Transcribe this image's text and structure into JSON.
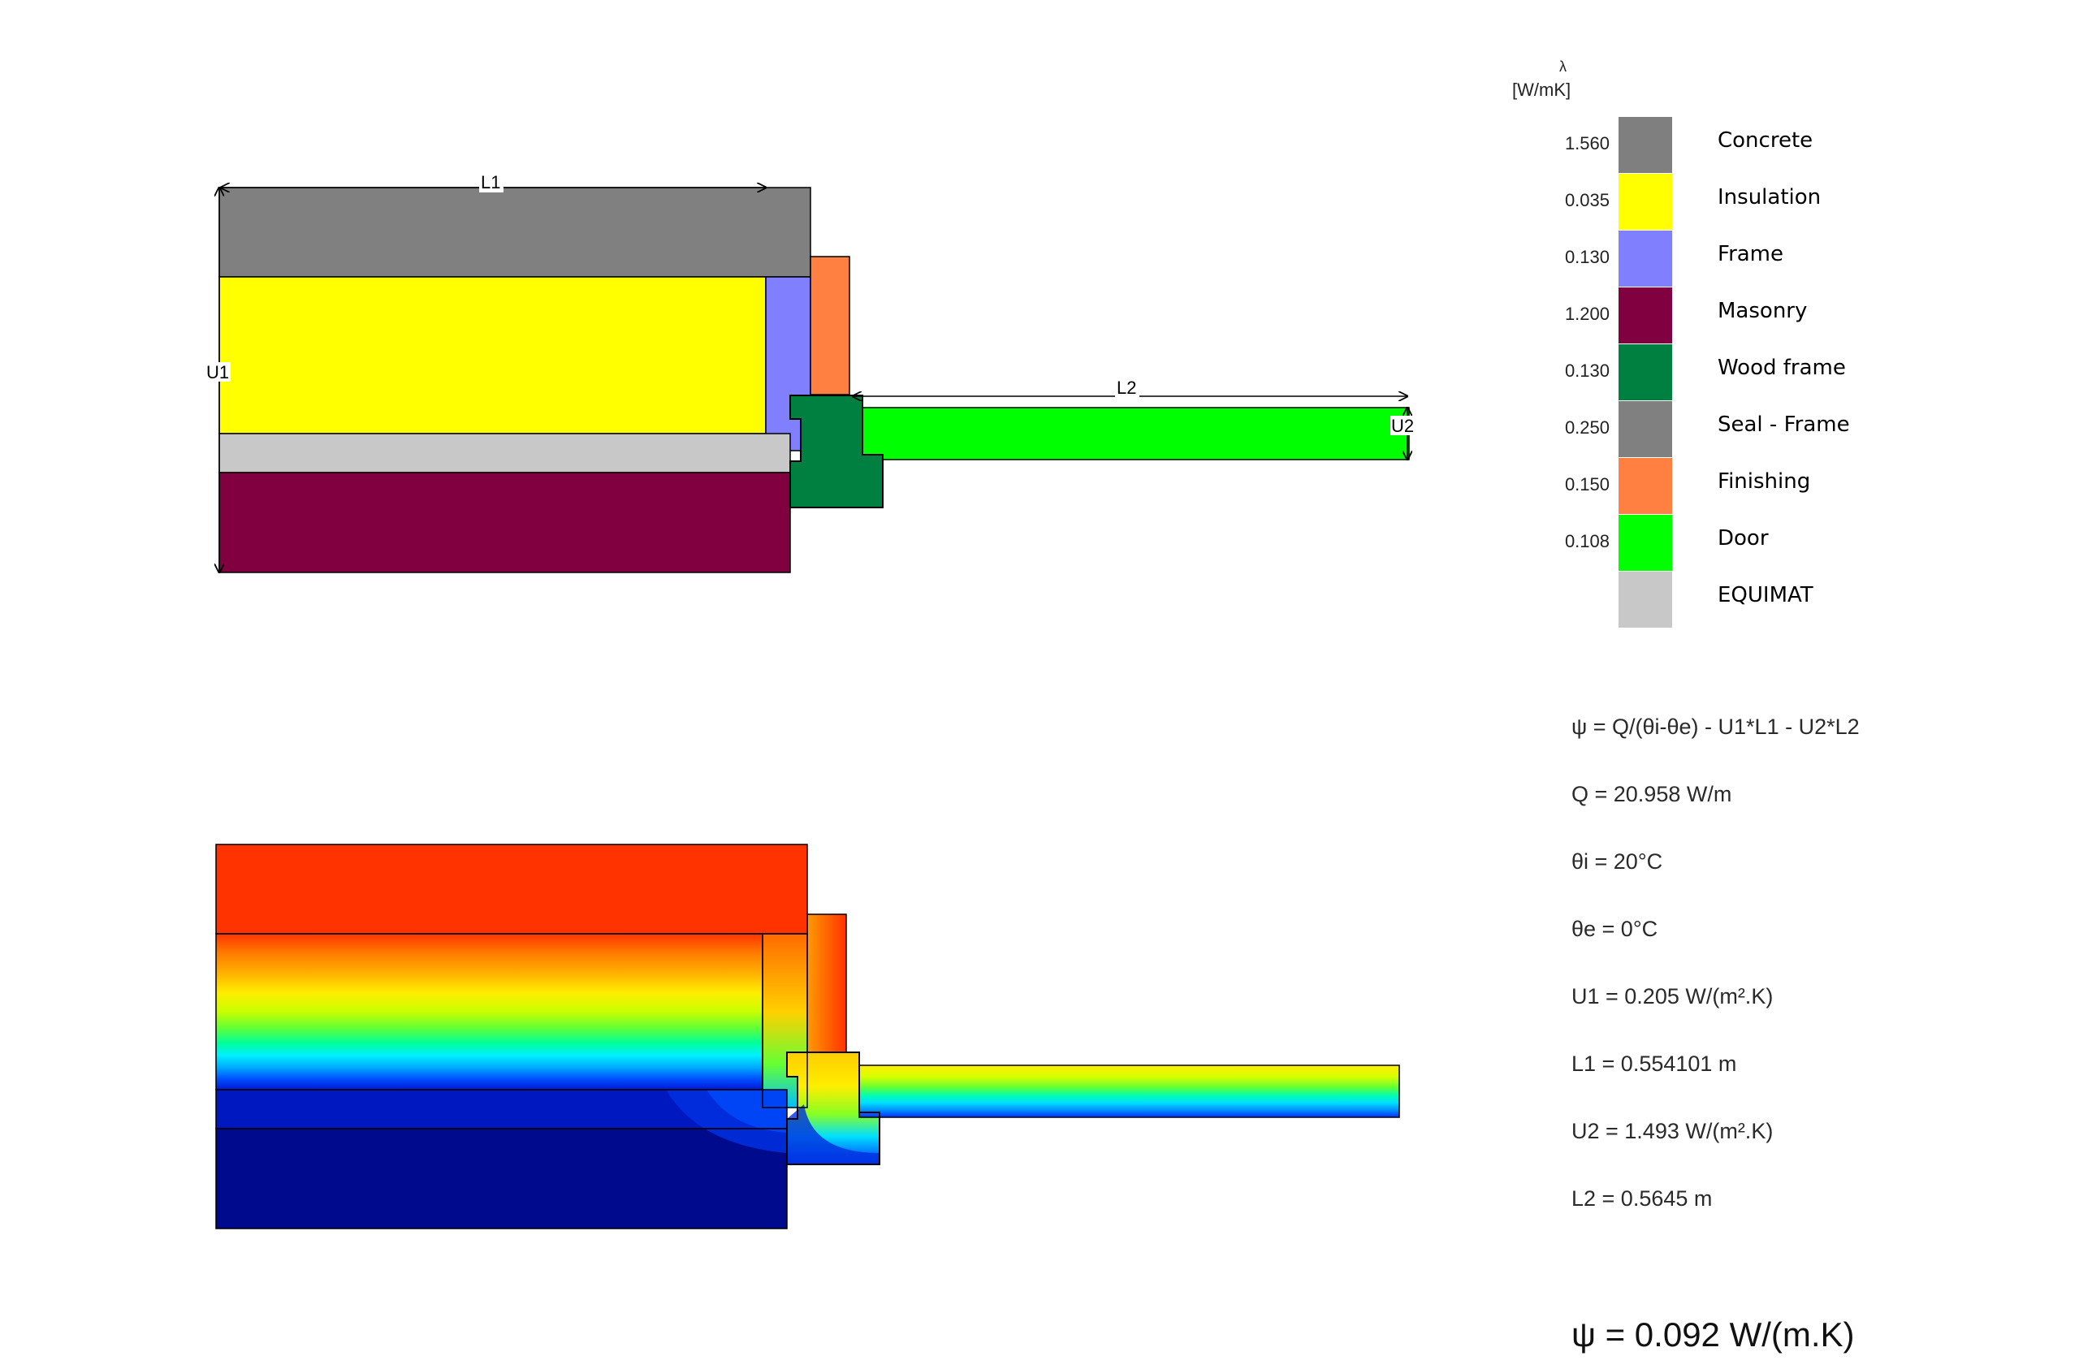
{
  "dimensions": {
    "l1": "L1",
    "l2": "L2",
    "u1": "U1",
    "u2": "U2"
  },
  "legend": {
    "lambda_symbol": "λ",
    "unit": "[W/mK]",
    "items": [
      {
        "value": "1.560",
        "name": "Concrete",
        "color": "#7f7f7f"
      },
      {
        "value": "0.035",
        "name": "Insulation",
        "color": "#ffff00"
      },
      {
        "value": "0.130",
        "name": "Frame",
        "color": "#8080ff"
      },
      {
        "value": "1.200",
        "name": "Masonry",
        "color": "#800040"
      },
      {
        "value": "0.130",
        "name": "Wood frame",
        "color": "#008040"
      },
      {
        "value": "0.250",
        "name": "Seal - Frame",
        "color": "#808080"
      },
      {
        "value": "0.150",
        "name": "Finishing",
        "color": "#ff8040"
      },
      {
        "value": "0.108",
        "name": "Door",
        "color": "#00ff00"
      },
      {
        "value": "",
        "name": "EQUIMAT",
        "color": "#c8c8c8"
      }
    ]
  },
  "formulas": {
    "psi_formula": "ψ = Q/(θi-θe) - U1*L1 - U2*L2",
    "q": "Q = 20.958 W/m",
    "theta_i": "θi = 20°C",
    "theta_e": "θe = 0°C",
    "u1": "U1 = 0.205 W/(m².K)",
    "l1": "L1 = 0.554101 m",
    "u2": "U2 = 1.493 W/(m².K)",
    "l2": "L2 = 0.5645 m"
  },
  "result": "ψ = 0.092 W/(m.K)",
  "colors": {
    "outline": "#000000",
    "thermal_hot": "#ff3300",
    "thermal_cold": "#000a8c"
  }
}
